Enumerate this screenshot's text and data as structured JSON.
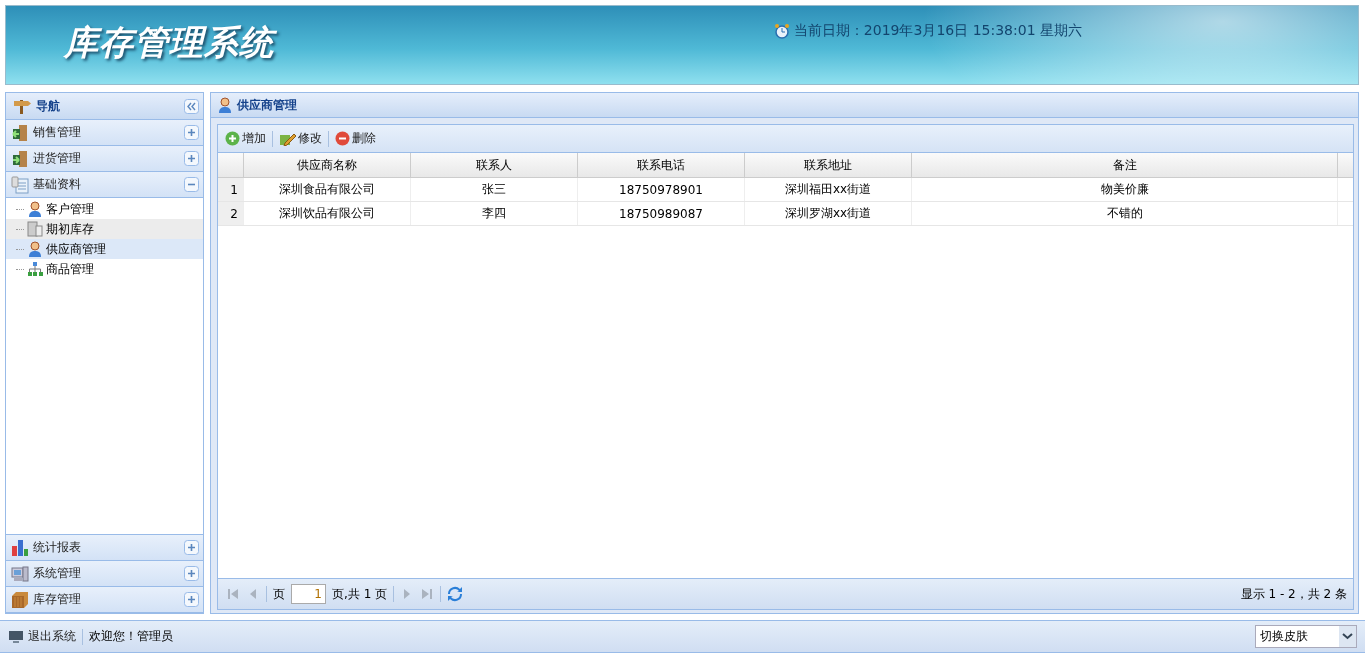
{
  "header": {
    "title": "库存管理系统",
    "datetime": "当前日期：2019年3月16日 15:38:01 星期六"
  },
  "nav": {
    "title": "导航",
    "sections": [
      {
        "name": "销售管理",
        "expanded": false
      },
      {
        "name": "进货管理",
        "expanded": false
      },
      {
        "name": "基础资料",
        "expanded": true,
        "children": [
          {
            "name": "客户管理",
            "selected": false,
            "hovered": false
          },
          {
            "name": "期初库存",
            "selected": false,
            "hovered": true
          },
          {
            "name": "供应商管理",
            "selected": true,
            "hovered": false
          },
          {
            "name": "商品管理",
            "selected": false,
            "hovered": false
          }
        ]
      },
      {
        "name": "统计报表",
        "expanded": false
      },
      {
        "name": "系统管理",
        "expanded": false
      },
      {
        "name": "库存管理",
        "expanded": false
      }
    ]
  },
  "main": {
    "title": "供应商管理",
    "toolbar": [
      {
        "kind": "add",
        "label": "增加"
      },
      {
        "kind": "edit",
        "label": "修改"
      },
      {
        "kind": "delete",
        "label": "删除"
      }
    ],
    "table": {
      "columns": [
        "供应商名称",
        "联系人",
        "联系电话",
        "联系地址",
        "备注"
      ],
      "rows": [
        {
          "number": "1",
          "cells": [
            "深圳食品有限公司",
            "张三",
            "18750978901",
            "深圳福田xx街道",
            "物美价廉"
          ]
        },
        {
          "number": "2",
          "cells": [
            "深圳饮品有限公司",
            "李四",
            "18750989087",
            "深圳罗湖xx街道",
            "不错的"
          ]
        }
      ]
    },
    "pager": {
      "page_label": "页",
      "page_value": "1",
      "page_total": "页,共 1 页",
      "summary": "显示 1 - 2，共 2 条"
    }
  },
  "status_bar": {
    "logout": "退出系统",
    "welcome": "欢迎您！管理员",
    "skin_select": "切换皮肤"
  }
}
